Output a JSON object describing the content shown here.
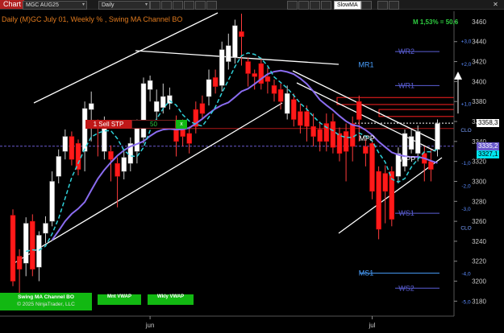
{
  "toolbar": {
    "chart_tab": "Chart",
    "instrument": "MGC AUG25",
    "period": "Daily",
    "indicator": "SlowMA"
  },
  "chart_title": "Daily (M)GC July 01, Weekly % , Swing MA Channel BO",
  "stats_text": "M 1,53% = 50,6",
  "order": {
    "label": "1 Sell STP",
    "qty": "50",
    "close": "x"
  },
  "buttons": {
    "swing_line1": "Swing MA Channel BO",
    "swing_line2": "© 2025 NinjaTrader, LLC",
    "mnt_vwap": "Mnt VWAP",
    "wkly_vwap": "Wkly VWAP"
  },
  "price_labels": [
    {
      "text": "3358,3",
      "value": 3358.3,
      "bg": "#ffffff",
      "fg": "#000000"
    },
    {
      "text": "3335,2",
      "value": 3335.2,
      "bg": "#6a5acd",
      "fg": "#ffffff"
    },
    {
      "text": "3327,1",
      "value": 3327.1,
      "bg": "#00e5ee",
      "fg": "#000000"
    }
  ],
  "level_labels": [
    {
      "text": "WR2",
      "value": 3430,
      "color": "#5b5fd6"
    },
    {
      "text": "MR1",
      "value": 3417,
      "color": "#4aa0ff"
    },
    {
      "text": "WR1",
      "value": 3396,
      "color": "#5b5fd6"
    },
    {
      "text": "MPP",
      "value": 3343,
      "color": "#ffffff"
    },
    {
      "text": "WPP",
      "value": 3322,
      "color": "#ffffff"
    },
    {
      "text": "WS1",
      "value": 3268,
      "color": "#5b5fd6"
    },
    {
      "text": "MS1",
      "value": 3208,
      "color": "#4aa0ff"
    },
    {
      "text": "WS2",
      "value": 3193,
      "color": "#5b5fd6"
    }
  ],
  "pct_labels": [
    "+3,0",
    "+2,0",
    "+1,0",
    "CLO",
    "-1,0",
    "-2,0",
    "-3,0",
    "CLO",
    "-4,0",
    "-5,0"
  ],
  "colors": {
    "up": "#ffffff",
    "down": "#ff1a1a",
    "ma_slow": "#8a6cf0",
    "ma_fast": "#2fd0d8",
    "axis": "#c8c8c8"
  },
  "chart_data": {
    "type": "candlestick",
    "ylim": [
      3165,
      3468
    ],
    "y_ticks": [
      3180,
      3200,
      3220,
      3240,
      3260,
      3280,
      3300,
      3320,
      3340,
      3360,
      3380,
      3400,
      3420,
      3440,
      3460
    ],
    "x_ticks": [
      {
        "label": "jun",
        "index": 21
      },
      {
        "label": "jul",
        "index": 55
      }
    ],
    "candles": [
      {
        "o": 3200,
        "c": 3266,
        "h": 3272,
        "l": 3195,
        "dir": "down"
      },
      {
        "o": 3212,
        "c": 3225,
        "h": 3232,
        "l": 3186,
        "dir": "down"
      },
      {
        "o": 3218,
        "c": 3258,
        "h": 3264,
        "l": 3205,
        "dir": "up"
      },
      {
        "o": 3260,
        "c": 3212,
        "h": 3267,
        "l": 3205,
        "dir": "down"
      },
      {
        "o": 3214,
        "c": 3246,
        "h": 3250,
        "l": 3200,
        "dir": "up"
      },
      {
        "o": 3248,
        "c": 3258,
        "h": 3265,
        "l": 3238,
        "dir": "up"
      },
      {
        "o": 3260,
        "c": 3300,
        "h": 3310,
        "l": 3255,
        "dir": "up"
      },
      {
        "o": 3305,
        "c": 3325,
        "h": 3332,
        "l": 3298,
        "dir": "up"
      },
      {
        "o": 3330,
        "c": 3345,
        "h": 3352,
        "l": 3322,
        "dir": "up"
      },
      {
        "o": 3322,
        "c": 3345,
        "h": 3350,
        "l": 3316,
        "dir": "down"
      },
      {
        "o": 3312,
        "c": 3338,
        "h": 3342,
        "l": 3306,
        "dir": "down"
      },
      {
        "o": 3330,
        "c": 3373,
        "h": 3380,
        "l": 3310,
        "dir": "up"
      },
      {
        "o": 3372,
        "c": 3378,
        "h": 3390,
        "l": 3340,
        "dir": "up"
      },
      {
        "o": 3355,
        "c": 3358,
        "h": 3362,
        "l": 3325,
        "dir": "down"
      },
      {
        "o": 3330,
        "c": 3360,
        "h": 3365,
        "l": 3322,
        "dir": "up"
      },
      {
        "o": 3322,
        "c": 3330,
        "h": 3336,
        "l": 3300,
        "dir": "down"
      },
      {
        "o": 3305,
        "c": 3318,
        "h": 3324,
        "l": 3274,
        "dir": "down"
      },
      {
        "o": 3310,
        "c": 3324,
        "h": 3330,
        "l": 3302,
        "dir": "up"
      },
      {
        "o": 3318,
        "c": 3338,
        "h": 3344,
        "l": 3310,
        "dir": "up"
      },
      {
        "o": 3330,
        "c": 3354,
        "h": 3362,
        "l": 3318,
        "dir": "up"
      },
      {
        "o": 3344,
        "c": 3398,
        "h": 3404,
        "l": 3338,
        "dir": "up"
      },
      {
        "o": 3392,
        "c": 3401,
        "h": 3406,
        "l": 3380,
        "dir": "up"
      },
      {
        "o": 3370,
        "c": 3380,
        "h": 3392,
        "l": 3358,
        "dir": "up"
      },
      {
        "o": 3374,
        "c": 3385,
        "h": 3398,
        "l": 3368,
        "dir": "up"
      },
      {
        "o": 3378,
        "c": 3386,
        "h": 3394,
        "l": 3372,
        "dir": "up"
      },
      {
        "o": 3340,
        "c": 3358,
        "h": 3366,
        "l": 3325,
        "dir": "down"
      },
      {
        "o": 3345,
        "c": 3352,
        "h": 3362,
        "l": 3335,
        "dir": "down"
      },
      {
        "o": 3338,
        "c": 3348,
        "h": 3355,
        "l": 3328,
        "dir": "down"
      },
      {
        "o": 3355,
        "c": 3372,
        "h": 3380,
        "l": 3348,
        "dir": "down"
      },
      {
        "o": 3368,
        "c": 3378,
        "h": 3386,
        "l": 3362,
        "dir": "down"
      },
      {
        "o": 3385,
        "c": 3402,
        "h": 3412,
        "l": 3376,
        "dir": "up"
      },
      {
        "o": 3395,
        "c": 3404,
        "h": 3412,
        "l": 3388,
        "dir": "down"
      },
      {
        "o": 3396,
        "c": 3432,
        "h": 3440,
        "l": 3390,
        "dir": "up"
      },
      {
        "o": 3420,
        "c": 3436,
        "h": 3448,
        "l": 3412,
        "dir": "up"
      },
      {
        "o": 3424,
        "c": 3456,
        "h": 3462,
        "l": 3418,
        "dir": "up"
      },
      {
        "o": 3445,
        "c": 3450,
        "h": 3468,
        "l": 3416,
        "dir": "down"
      },
      {
        "o": 3408,
        "c": 3420,
        "h": 3424,
        "l": 3395,
        "dir": "down"
      },
      {
        "o": 3405,
        "c": 3408,
        "h": 3412,
        "l": 3392,
        "dir": "down"
      },
      {
        "o": 3398,
        "c": 3418,
        "h": 3424,
        "l": 3392,
        "dir": "down"
      },
      {
        "o": 3400,
        "c": 3405,
        "h": 3414,
        "l": 3388,
        "dir": "down"
      },
      {
        "o": 3388,
        "c": 3396,
        "h": 3402,
        "l": 3380,
        "dir": "down"
      },
      {
        "o": 3380,
        "c": 3392,
        "h": 3398,
        "l": 3372,
        "dir": "down"
      },
      {
        "o": 3368,
        "c": 3388,
        "h": 3396,
        "l": 3362,
        "dir": "up"
      },
      {
        "o": 3362,
        "c": 3382,
        "h": 3388,
        "l": 3355,
        "dir": "down"
      },
      {
        "o": 3356,
        "c": 3370,
        "h": 3378,
        "l": 3348,
        "dir": "down"
      },
      {
        "o": 3355,
        "c": 3370,
        "h": 3376,
        "l": 3340,
        "dir": "down"
      },
      {
        "o": 3345,
        "c": 3355,
        "h": 3368,
        "l": 3335,
        "dir": "down"
      },
      {
        "o": 3340,
        "c": 3352,
        "h": 3360,
        "l": 3330,
        "dir": "down"
      },
      {
        "o": 3340,
        "c": 3358,
        "h": 3368,
        "l": 3330,
        "dir": "down"
      },
      {
        "o": 3334,
        "c": 3360,
        "h": 3368,
        "l": 3328,
        "dir": "down"
      },
      {
        "o": 3328,
        "c": 3348,
        "h": 3354,
        "l": 3320,
        "dir": "down"
      },
      {
        "o": 3330,
        "c": 3350,
        "h": 3358,
        "l": 3300,
        "dir": "down"
      },
      {
        "o": 3335,
        "c": 3358,
        "h": 3365,
        "l": 3320,
        "dir": "down"
      },
      {
        "o": 3362,
        "c": 3380,
        "h": 3386,
        "l": 3340,
        "dir": "down"
      },
      {
        "o": 3335,
        "c": 3328,
        "h": 3342,
        "l": 3315,
        "dir": "down"
      },
      {
        "o": 3290,
        "c": 3338,
        "h": 3342,
        "l": 3282,
        "dir": "down"
      },
      {
        "o": 3252,
        "c": 3310,
        "h": 3315,
        "l": 3242,
        "dir": "down"
      },
      {
        "o": 3290,
        "c": 3308,
        "h": 3316,
        "l": 3258,
        "dir": "down"
      },
      {
        "o": 3262,
        "c": 3310,
        "h": 3315,
        "l": 3255,
        "dir": "down"
      },
      {
        "o": 3305,
        "c": 3328,
        "h": 3334,
        "l": 3298,
        "dir": "up"
      },
      {
        "o": 3315,
        "c": 3348,
        "h": 3352,
        "l": 3310,
        "dir": "up"
      },
      {
        "o": 3332,
        "c": 3345,
        "h": 3352,
        "l": 3328,
        "dir": "up"
      },
      {
        "o": 3328,
        "c": 3350,
        "h": 3356,
        "l": 3320,
        "dir": "up"
      },
      {
        "o": 3318,
        "c": 3328,
        "h": 3335,
        "l": 3300,
        "dir": "down"
      },
      {
        "o": 3312,
        "c": 3320,
        "h": 3332,
        "l": 3300,
        "dir": "down"
      },
      {
        "o": 3332,
        "c": 3358,
        "h": 3362,
        "l": 3325,
        "dir": "up"
      }
    ]
  }
}
